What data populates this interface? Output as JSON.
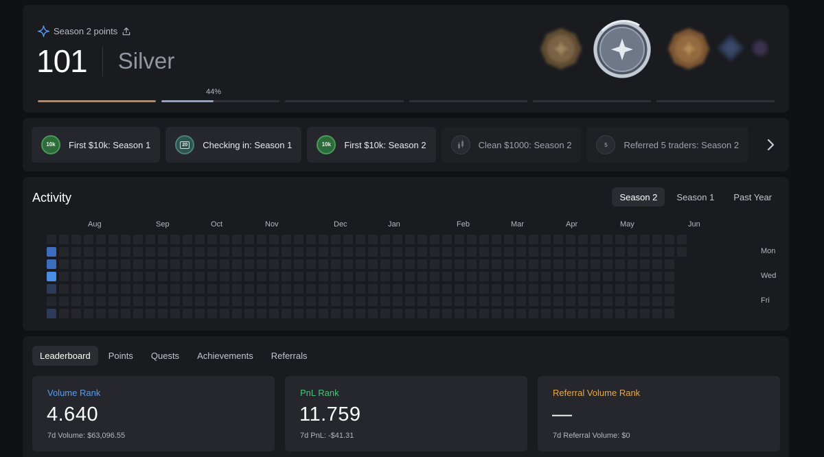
{
  "season": {
    "label": "Season 2 points",
    "points": "101",
    "tier": "Silver",
    "progress_label": "44%",
    "progress_value": 0.44,
    "segments": [
      {
        "fill": 1.0,
        "color": "#a88c74"
      },
      {
        "fill": 0.44,
        "color": "#9aa3b5"
      },
      {
        "fill": 0,
        "color": "#2f3137"
      },
      {
        "fill": 0,
        "color": "#2f3137"
      },
      {
        "fill": 0,
        "color": "#2f3137"
      },
      {
        "fill": 0,
        "color": "#2f3137"
      }
    ],
    "tier_badges": [
      "bronze-badge-icon",
      "silver-badge-icon",
      "gold-badge-icon",
      "platinum-badge-icon",
      "diamond-badge-icon"
    ]
  },
  "achievements": [
    {
      "label": "First $10k: Season 1",
      "icon": "dollar-10k-icon",
      "icon_text": "10k",
      "locked": false
    },
    {
      "label": "Checking in: Season 1",
      "icon": "calendar-icon",
      "icon_text": "20",
      "locked": false
    },
    {
      "label": "First $10k: Season 2",
      "icon": "dollar-10k-icon",
      "icon_text": "10k",
      "locked": false
    },
    {
      "label": "Clean $1000: Season 2",
      "icon": "candle-icon",
      "icon_text": "",
      "locked": true
    },
    {
      "label": "Referred 5 traders: Season 2",
      "icon": "people-icon",
      "icon_text": "5",
      "locked": true
    }
  ],
  "activity": {
    "title": "Activity",
    "tabs": [
      "Season 2",
      "Season 1",
      "Past Year"
    ],
    "active_tab": 0,
    "months": [
      "Aug",
      "Sep",
      "Oct",
      "Nov",
      "Dec",
      "Jan",
      "Feb",
      "Mar",
      "Apr",
      "May",
      "Jun"
    ],
    "days": [
      "Mon",
      "Wed",
      "Fri"
    ],
    "active_cells": [
      {
        "week": 0,
        "day": 1,
        "level": 2
      },
      {
        "week": 0,
        "day": 2,
        "level": 2
      },
      {
        "week": 0,
        "day": 3,
        "level": 3
      },
      {
        "week": 0,
        "day": 4,
        "level": 1
      },
      {
        "week": 0,
        "day": 6,
        "level": 1
      }
    ],
    "colors": {
      "empty": "#24262b",
      "level1": "#2b3b58",
      "level2": "#3d6dbd",
      "level3": "#4a8ee3"
    }
  },
  "leaderboard": {
    "tabs": [
      "Leaderboard",
      "Points",
      "Quests",
      "Achievements",
      "Referrals"
    ],
    "active_tab": 0,
    "cards": [
      {
        "label": "Volume Rank",
        "color": "#5a9cf2",
        "value": "4.640",
        "sub": "7d Volume: $63,096.55"
      },
      {
        "label": "PnL Rank",
        "color": "#4fc27a",
        "value": "11.759",
        "sub": "7d PnL: -$41.31"
      },
      {
        "label": "Referral Volume Rank",
        "color": "#e8a84a",
        "value": "—",
        "sub": "7d Referral Volume: $0"
      }
    ]
  }
}
